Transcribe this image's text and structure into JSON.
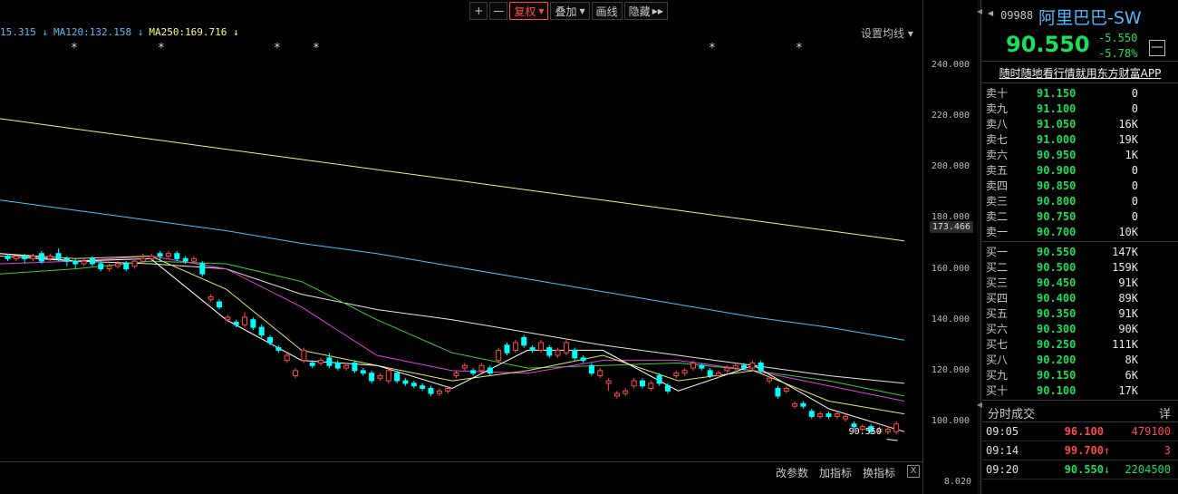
{
  "toolbar": {
    "zoom_in": "+",
    "zoom_out": "—",
    "fuquan": "复权",
    "diejia": "叠加",
    "huaxian": "画线",
    "yincang": "隐藏",
    "hide_arrows": "▶▶"
  },
  "ma_legend": [
    {
      "text": "15.315 ↓",
      "color": "#4fc3ff"
    },
    {
      "text": "MA120:132.158 ↓",
      "color": "#4fc3ff"
    },
    {
      "text": "MA250:169.716 ↓",
      "color": "#ffff66"
    }
  ],
  "settings_label": "设置均线 ▾",
  "y_axis": {
    "ticks": [
      "240.000",
      "220.000",
      "200.000",
      "180.000",
      "160.000",
      "140.000",
      "120.000",
      "100.000"
    ],
    "current_price_label": "173.466",
    "sub_tick": "8.020"
  },
  "price_tag": "90.550",
  "bottom": {
    "change_params": "改参数",
    "add_indicator": "加指标",
    "swap_indicator": "换指标",
    "close": "X"
  },
  "quote": {
    "code": "09988",
    "name": "阿里巴巴-SW",
    "price": "90.550",
    "change": "-5.550",
    "change_pct": "-5.78%",
    "collapse": "—",
    "ad": "随时随地看行情就用东方财富APP",
    "sells": [
      {
        "label": "卖十",
        "price": "91.150",
        "vol": "0"
      },
      {
        "label": "卖九",
        "price": "91.100",
        "vol": "0"
      },
      {
        "label": "卖八",
        "price": "91.050",
        "vol": "16K"
      },
      {
        "label": "卖七",
        "price": "91.000",
        "vol": "19K"
      },
      {
        "label": "卖六",
        "price": "90.950",
        "vol": "1K"
      },
      {
        "label": "卖五",
        "price": "90.900",
        "vol": "0"
      },
      {
        "label": "卖四",
        "price": "90.850",
        "vol": "0"
      },
      {
        "label": "卖三",
        "price": "90.800",
        "vol": "0"
      },
      {
        "label": "卖二",
        "price": "90.750",
        "vol": "0"
      },
      {
        "label": "卖一",
        "price": "90.700",
        "vol": "10K"
      }
    ],
    "buys": [
      {
        "label": "买一",
        "price": "90.550",
        "vol": "147K"
      },
      {
        "label": "买二",
        "price": "90.500",
        "vol": "159K"
      },
      {
        "label": "买三",
        "price": "90.450",
        "vol": "91K"
      },
      {
        "label": "买四",
        "price": "90.400",
        "vol": "89K"
      },
      {
        "label": "买五",
        "price": "90.350",
        "vol": "91K"
      },
      {
        "label": "买六",
        "price": "90.300",
        "vol": "90K"
      },
      {
        "label": "买七",
        "price": "90.250",
        "vol": "111K"
      },
      {
        "label": "买八",
        "price": "90.200",
        "vol": "8K"
      },
      {
        "label": "买九",
        "price": "90.150",
        "vol": "6K"
      },
      {
        "label": "买十",
        "price": "90.100",
        "vol": "17K"
      }
    ],
    "ticks_title": "分时成交",
    "ticks_detail": "详",
    "ticks": [
      {
        "time": "09:05",
        "price": "96.100",
        "dir": "",
        "vol": "479100",
        "color": "#ff4a4a"
      },
      {
        "time": "09:14",
        "price": "99.700",
        "dir": "↑",
        "vol": "3",
        "color": "#ff4a4a"
      },
      {
        "time": "09:20",
        "price": "90.550",
        "dir": "↓",
        "vol": "2204500",
        "color": "#18e05a"
      }
    ]
  },
  "chart_data": {
    "type": "candlestick",
    "ylim": [
      92,
      248
    ],
    "y_ticks": [
      240,
      220,
      200,
      180,
      160,
      140,
      120,
      100
    ],
    "colors": {
      "up": "#ff4a4a",
      "down": "#00ffff"
    },
    "candles": [
      [
        165,
        164,
        166,
        163
      ],
      [
        164,
        165,
        166,
        163
      ],
      [
        165,
        164,
        166,
        162
      ],
      [
        164,
        165,
        166,
        163
      ],
      [
        166,
        163,
        167,
        162
      ],
      [
        164,
        165,
        166,
        163
      ],
      [
        166,
        164,
        168,
        163
      ],
      [
        164,
        163,
        165,
        161
      ],
      [
        163,
        162,
        164,
        160
      ],
      [
        162,
        163,
        164,
        161
      ],
      [
        164,
        162,
        165,
        161
      ],
      [
        162,
        160,
        163,
        159
      ],
      [
        160,
        161,
        162,
        159
      ],
      [
        161,
        162,
        163,
        160
      ],
      [
        162,
        160,
        163,
        159
      ],
      [
        161,
        163,
        164,
        160
      ],
      [
        163,
        164,
        166,
        162
      ],
      [
        164,
        165,
        166,
        163
      ],
      [
        166,
        165,
        167,
        163
      ],
      [
        165,
        166,
        167,
        164
      ],
      [
        166,
        164,
        167,
        163
      ],
      [
        164,
        163,
        165,
        162
      ],
      [
        163,
        164,
        165,
        162
      ],
      [
        162,
        158,
        163,
        157
      ],
      [
        148,
        149,
        150,
        147
      ],
      [
        147,
        145,
        148,
        144
      ],
      [
        140,
        141,
        142,
        139
      ],
      [
        139,
        138,
        140,
        137
      ],
      [
        138,
        141,
        143,
        137
      ],
      [
        140,
        137,
        141,
        136
      ],
      [
        137,
        134,
        138,
        133
      ],
      [
        133,
        131,
        134,
        130
      ],
      [
        129,
        128,
        130,
        127
      ],
      [
        124,
        126,
        127,
        123
      ],
      [
        118,
        120,
        121,
        117
      ],
      [
        124,
        128,
        129,
        123
      ],
      [
        123,
        122,
        124,
        121
      ],
      [
        123,
        124,
        125,
        122
      ],
      [
        125,
        122,
        127,
        121
      ],
      [
        123,
        121,
        124,
        120
      ],
      [
        121,
        122,
        123,
        120
      ],
      [
        123,
        120,
        124,
        119
      ],
      [
        120,
        119,
        121,
        118
      ],
      [
        119,
        116,
        120,
        115
      ],
      [
        117,
        118,
        119,
        116
      ],
      [
        116,
        120,
        121,
        115
      ],
      [
        119,
        116,
        120,
        115
      ],
      [
        116,
        115,
        117,
        114
      ],
      [
        115,
        114,
        116,
        113
      ],
      [
        114,
        113,
        115,
        112
      ],
      [
        113,
        111,
        114,
        110
      ],
      [
        111,
        112,
        113,
        110
      ],
      [
        112,
        113,
        114,
        111
      ],
      [
        118,
        119,
        120,
        117
      ],
      [
        121,
        122,
        123,
        120
      ],
      [
        120,
        119,
        121,
        118
      ],
      [
        120,
        122,
        123,
        119
      ],
      [
        121,
        119,
        122,
        118
      ],
      [
        124,
        128,
        129,
        123
      ],
      [
        130,
        127,
        131,
        126
      ],
      [
        128,
        131,
        132,
        127
      ],
      [
        133,
        130,
        134,
        129
      ],
      [
        129,
        128,
        130,
        127
      ],
      [
        128,
        131,
        132,
        127
      ],
      [
        129,
        126,
        130,
        125
      ],
      [
        126,
        128,
        129,
        125
      ],
      [
        127,
        131,
        132,
        126
      ],
      [
        128,
        125,
        129,
        124
      ],
      [
        125,
        124,
        126,
        123
      ],
      [
        122,
        119,
        123,
        118
      ],
      [
        118,
        120,
        121,
        117
      ],
      [
        115,
        116,
        117,
        112
      ],
      [
        110,
        111,
        112,
        109
      ],
      [
        111,
        112,
        113,
        110
      ],
      [
        114,
        116,
        117,
        113
      ],
      [
        116,
        114,
        117,
        113
      ],
      [
        113,
        115,
        116,
        112
      ],
      [
        118,
        115,
        119,
        114
      ],
      [
        114,
        112,
        115,
        111
      ],
      [
        118,
        119,
        120,
        117
      ],
      [
        119,
        120,
        121,
        118
      ],
      [
        121,
        123,
        124,
        120
      ],
      [
        122,
        121,
        123,
        120
      ],
      [
        120,
        118,
        121,
        117
      ],
      [
        118,
        119,
        120,
        117
      ],
      [
        120,
        121,
        122,
        119
      ],
      [
        121,
        122,
        123,
        120
      ],
      [
        122,
        121,
        123,
        120
      ],
      [
        121,
        123,
        124,
        120
      ],
      [
        123,
        120,
        124,
        119
      ],
      [
        116,
        117,
        118,
        115
      ],
      [
        113,
        110,
        114,
        109
      ],
      [
        112,
        113,
        114,
        111
      ],
      [
        106,
        107,
        108,
        105
      ],
      [
        107,
        106,
        108,
        105
      ],
      [
        104,
        102,
        105,
        101
      ],
      [
        102,
        103,
        104,
        101
      ],
      [
        103,
        102,
        104,
        101
      ],
      [
        102,
        103,
        104,
        101
      ],
      [
        101,
        102,
        103,
        100
      ],
      [
        99,
        98,
        100,
        97
      ],
      [
        97,
        98,
        99,
        96
      ],
      [
        98,
        96,
        99,
        95
      ],
      [
        96,
        97,
        98,
        95
      ],
      [
        96,
        97,
        98,
        95
      ],
      [
        96,
        99,
        100,
        95
      ]
    ],
    "ma_lines": [
      {
        "name": "MA250",
        "color": "#f0f07a",
        "values": [
          219,
          215,
          211,
          207,
          203,
          199,
          195,
          191,
          187,
          183,
          179,
          175,
          171
        ]
      },
      {
        "name": "MA120",
        "color": "#3ec8ff",
        "values": [
          187,
          183,
          179,
          175,
          170,
          166,
          161,
          156,
          151,
          146,
          141,
          137,
          132
        ]
      },
      {
        "name": "white",
        "color": "#e6e6e6",
        "values": [
          165,
          163,
          162,
          160,
          150,
          144,
          140,
          135,
          130,
          126,
          122,
          118,
          115
        ]
      },
      {
        "name": "green",
        "color": "#3ccc3c",
        "values": [
          158,
          160,
          163,
          162,
          155,
          140,
          127,
          121,
          122,
          123,
          120,
          116,
          110
        ]
      },
      {
        "name": "magenta",
        "color": "#e040e0",
        "values": [
          162,
          163,
          165,
          160,
          145,
          126,
          120,
          119,
          124,
          124,
          120,
          114,
          108
        ]
      },
      {
        "name": "yellow",
        "color": "#e8e860",
        "values": [
          166,
          164,
          165,
          152,
          128,
          122,
          116,
          120,
          126,
          116,
          120,
          108,
          103
        ]
      },
      {
        "name": "white2",
        "color": "#ffffff",
        "values": [
          166,
          163,
          164,
          140,
          124,
          122,
          113,
          128,
          128,
          112,
          122,
          105,
          96
        ]
      }
    ]
  }
}
